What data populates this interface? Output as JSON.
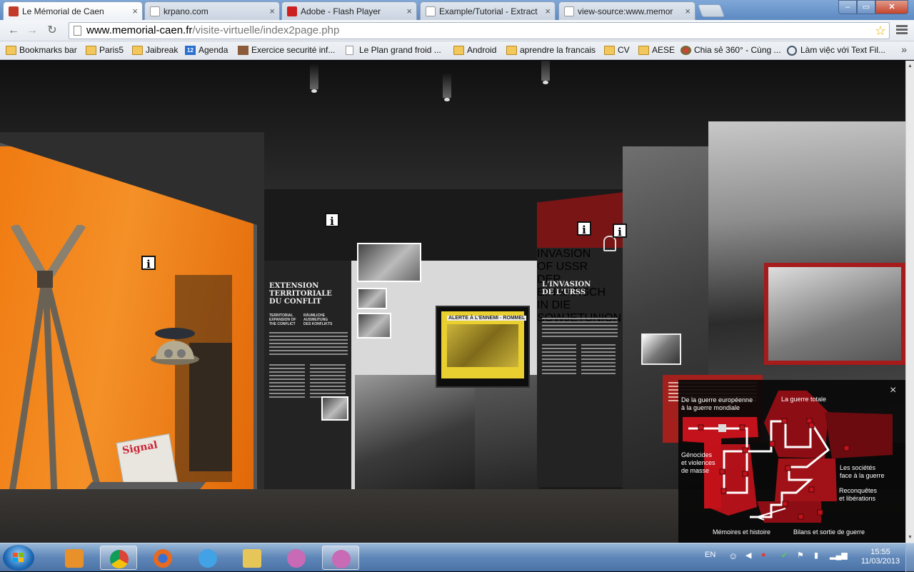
{
  "browser": {
    "tabs": [
      {
        "title": "Le Mémorial de Caen",
        "favicon_color": "#c23a2a",
        "active": true
      },
      {
        "title": "krpano.com",
        "favicon_color": "#ffffff",
        "active": false
      },
      {
        "title": "Adobe - Flash Player",
        "favicon_color": "#cc1f1f",
        "active": false
      },
      {
        "title": "Example/Tutorial - Extract",
        "favicon_color": "#ffffff",
        "active": false
      },
      {
        "title": "view-source:www.memor",
        "favicon_color": "#ffffff",
        "active": false
      }
    ],
    "address": {
      "domain": "www.memorial-caen.fr",
      "path": "/visite-virtuelle/index2page.php"
    },
    "bookmarks": [
      {
        "label": "Bookmarks bar",
        "icon": "folder-icon"
      },
      {
        "label": "Paris5",
        "icon": "folder-icon"
      },
      {
        "label": "Jaibreak",
        "icon": "folder-icon"
      },
      {
        "label": "Agenda",
        "icon": "calendar-icon"
      },
      {
        "label": "Exercice securité inf...",
        "icon": "page-icon"
      },
      {
        "label": "Le Plan grand froid ...",
        "icon": "page-icon"
      },
      {
        "label": "Android",
        "icon": "folder-icon"
      },
      {
        "label": "aprendre la francais",
        "icon": "folder-icon"
      },
      {
        "label": "CV",
        "icon": "folder-icon"
      },
      {
        "label": "AESE",
        "icon": "folder-icon"
      },
      {
        "label": "Chia sẻ 360° - Cùng ...",
        "icon": "globe-icon"
      },
      {
        "label": "Làm việc với Text Fil...",
        "icon": "wordpress-icon"
      }
    ],
    "agenda_badge": "12",
    "more_label": "»"
  },
  "exhibit": {
    "panel_left": {
      "title": "EXTENSION\nTERRITORIALE\nDU CONFLIT",
      "sub_en": "TERRITORIAL\nEXPANSION OF\nTHE CONFLICT",
      "sub_de": "RÄUMLICHE\nAUSWEITUNG\nDES KONFLIKTS"
    },
    "framed_poster": "ALERTE À L'ENNEMI - ROMMEL",
    "panel_right": {
      "title": "L'INVASION\nDE L'URSS",
      "sub": "INVASION\nOF USSR",
      "sub_de": "DER EINMARSCH\nIN DIE SOWJETUNION"
    },
    "magazine_title": "Signal",
    "info_glyph": "i"
  },
  "map": {
    "labels": {
      "europe": "De la guerre  européenne\nà la guerre mondiale",
      "totale": "La guerre totale",
      "genocides": "Génocides\net violences\nde masse",
      "societes": "Les sociétés\nface à la guerre",
      "reconquetes": "Reconquêtes\net libérations",
      "memoires": "Mémoires et histoire",
      "bilans": "Bilans et sortie de guerre"
    },
    "close": "×",
    "colors": {
      "zone": "#c3121b",
      "zone_dark": "#8c0e14",
      "path": "#ffffff",
      "current": "#dcdcdc"
    }
  },
  "taskbar": {
    "lang": "EN",
    "time": "15:55",
    "date": "11/03/2013",
    "apps": [
      {
        "name": "media-player-icon",
        "color": "#e8912a"
      },
      {
        "name": "chrome-icon",
        "color": "#3d8fe0"
      },
      {
        "name": "firefox-icon",
        "color": "#e86a1e"
      },
      {
        "name": "ie-icon",
        "color": "#41a3e6"
      },
      {
        "name": "explorer-icon",
        "color": "#e7c659"
      },
      {
        "name": "messenger-icon",
        "color": "#c86ab5"
      },
      {
        "name": "messenger-icon",
        "color": "#c86ab5"
      }
    ]
  }
}
